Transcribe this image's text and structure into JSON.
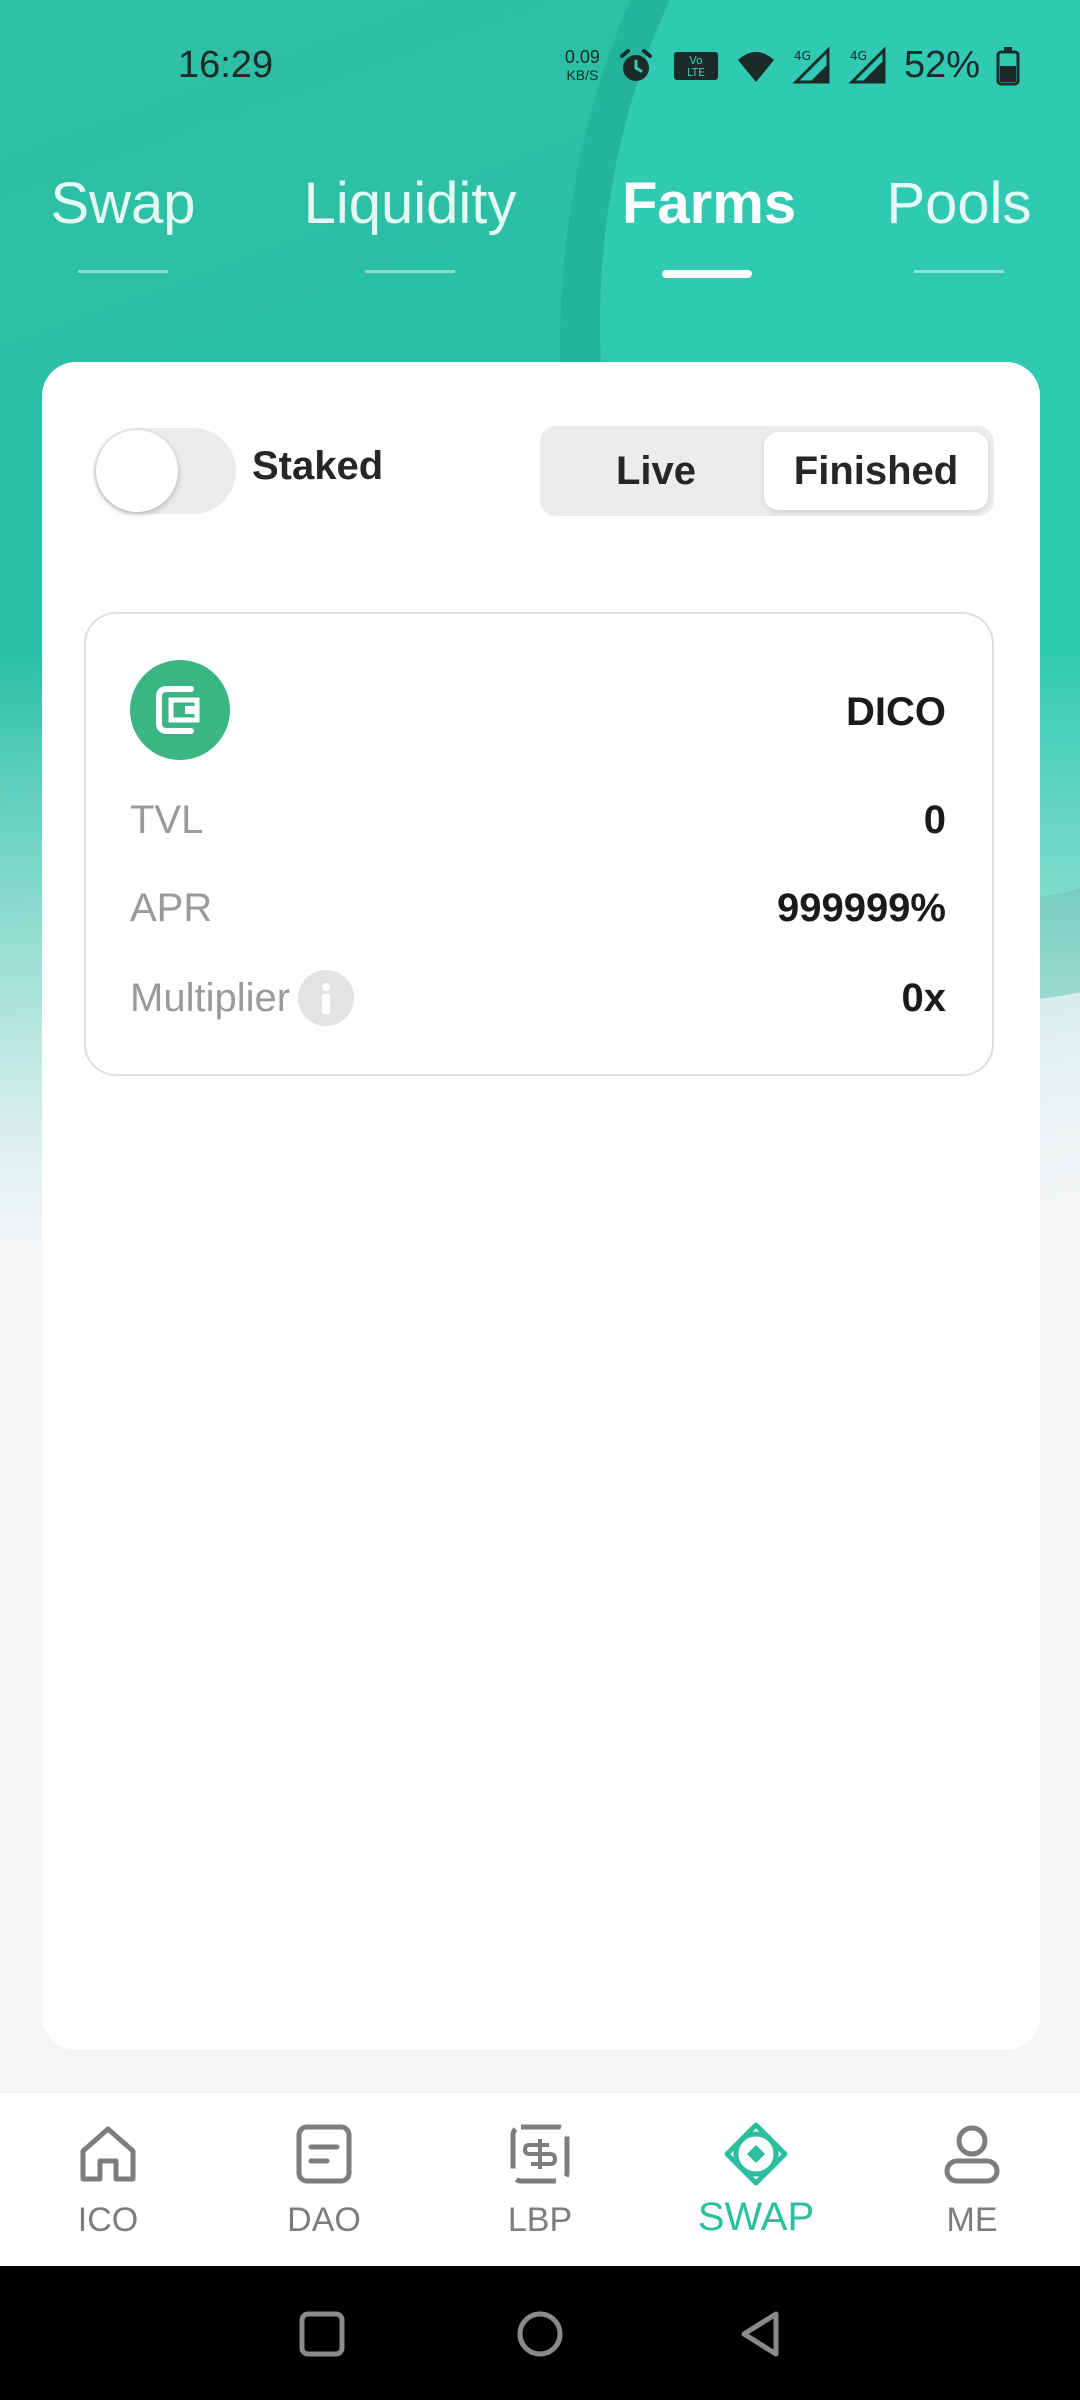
{
  "status_bar": {
    "time": "16:29",
    "net_speed_value": "0.09",
    "net_speed_unit": "KB/S",
    "volte": "Vo LTE",
    "sim1": "4G",
    "sim2": "4G",
    "battery_percent": "52%"
  },
  "top_tabs": [
    {
      "label": "Swap",
      "active": false
    },
    {
      "label": "Liquidity",
      "active": false
    },
    {
      "label": "Farms",
      "active": true
    },
    {
      "label": "Pools",
      "active": false
    }
  ],
  "filters": {
    "staked_label": "Staked",
    "staked_on": false,
    "segment": {
      "live_label": "Live",
      "finished_label": "Finished",
      "selected": "Finished"
    }
  },
  "farm": {
    "token_name": "DICO",
    "logo_icon": "dico-logo-icon",
    "rows": {
      "tvl_label": "TVL",
      "tvl_value": "0",
      "apr_label": "APR",
      "apr_value": "999999%",
      "multiplier_label": "Multiplier",
      "multiplier_value": "0x"
    }
  },
  "bottom_nav": [
    {
      "label": "ICO",
      "icon": "home-icon",
      "active": false
    },
    {
      "label": "DAO",
      "icon": "document-icon",
      "active": false
    },
    {
      "label": "LBP",
      "icon": "exchange-dollar-icon",
      "active": false
    },
    {
      "label": "SWAP",
      "icon": "swap-diamond-icon",
      "active": true
    },
    {
      "label": "ME",
      "icon": "user-icon",
      "active": false
    }
  ],
  "colors": {
    "accent": "#2bbf9e",
    "header_teal": "#28c0a6",
    "token_green": "#3bb584"
  }
}
